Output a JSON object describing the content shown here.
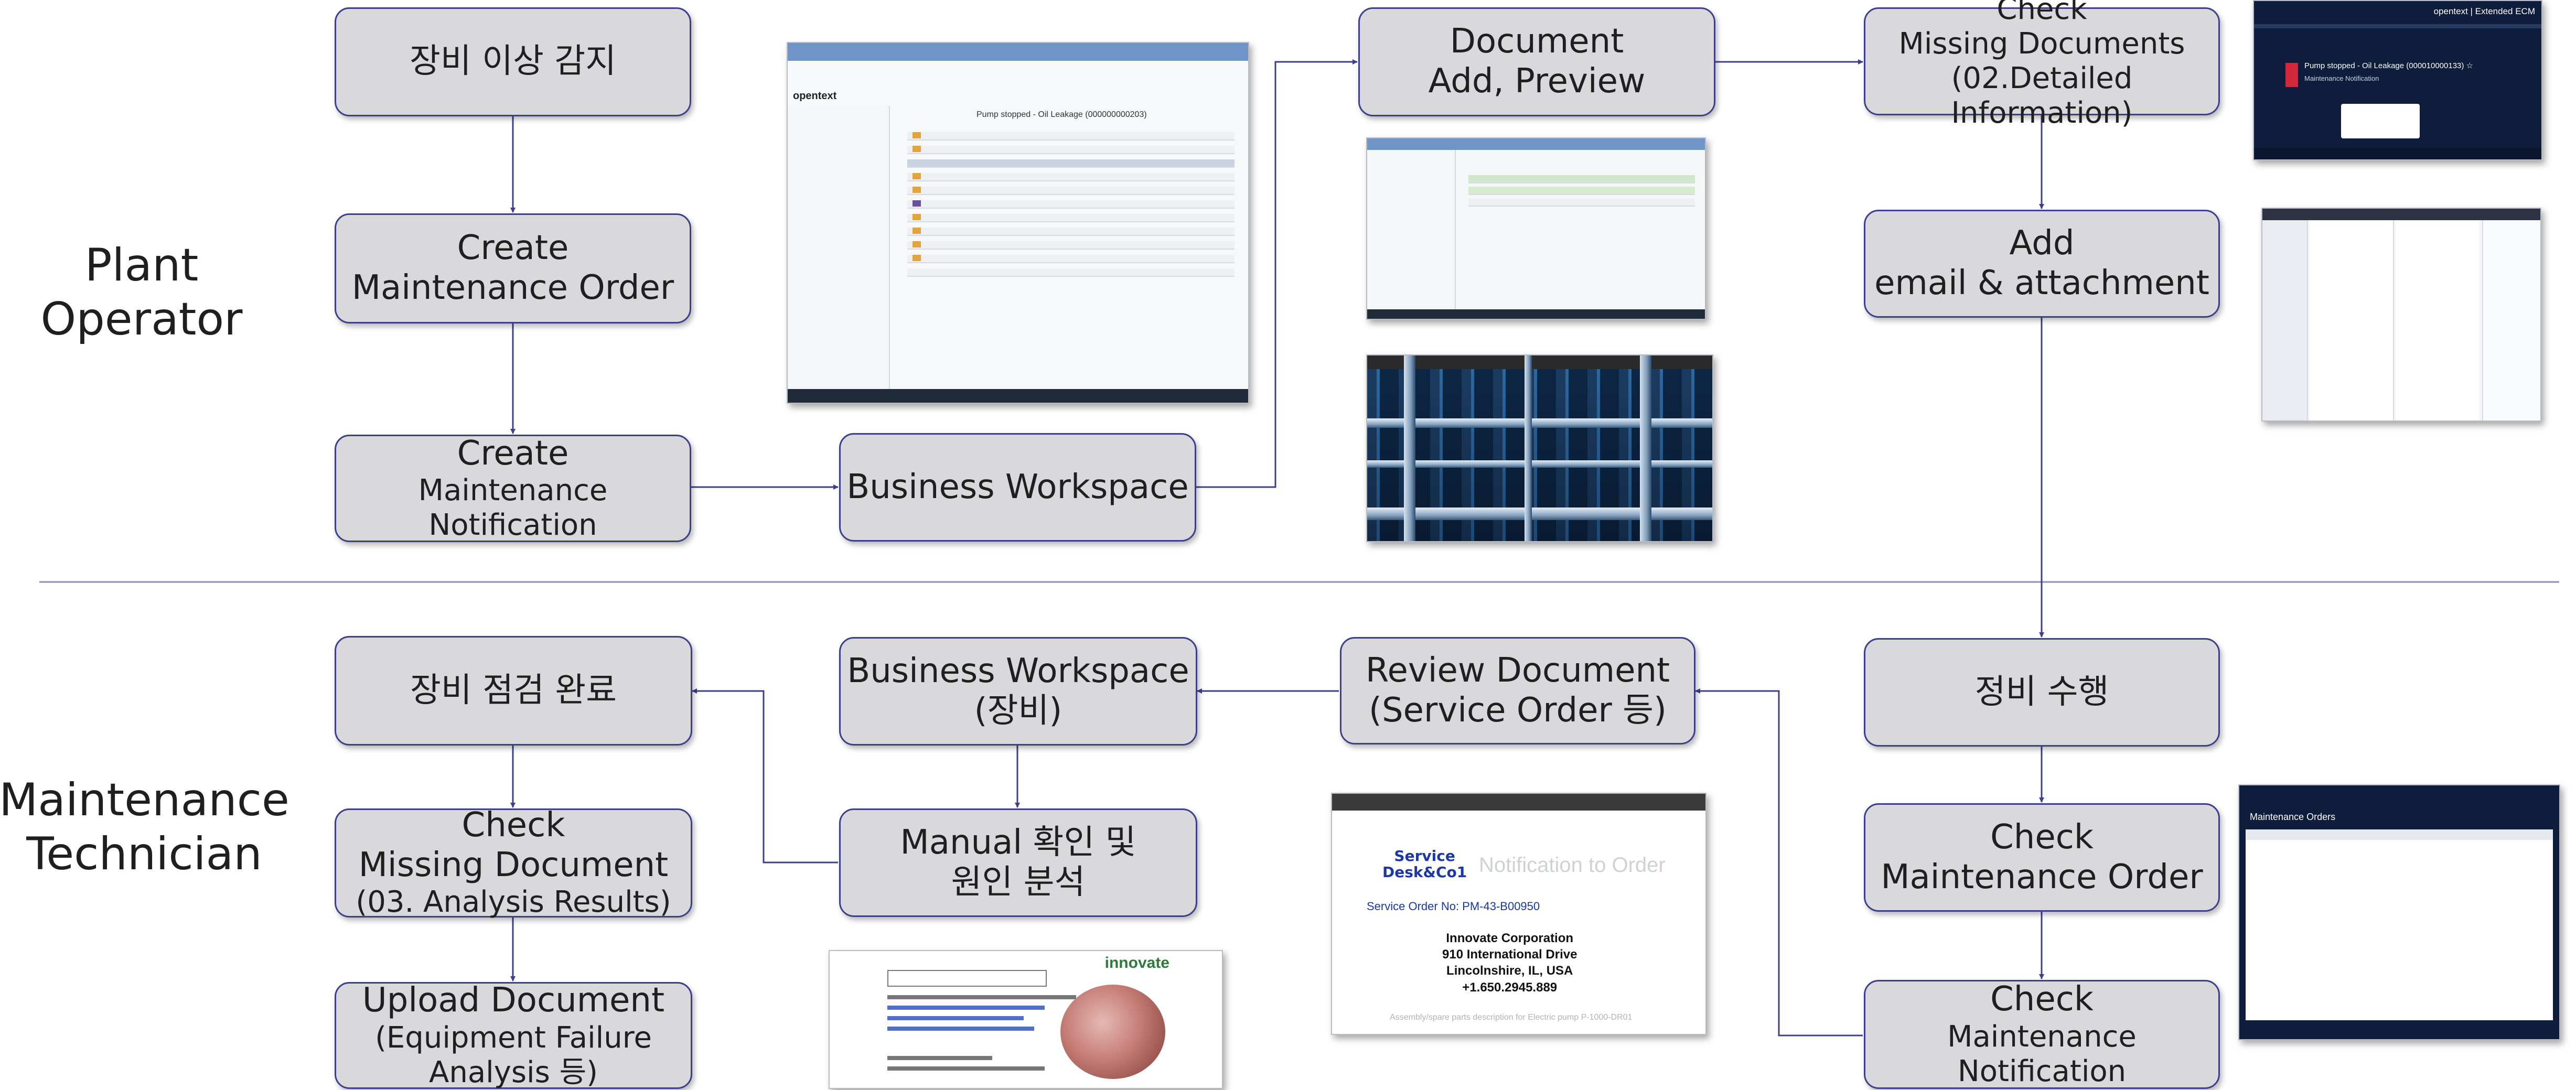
{
  "lanes": {
    "plant_operator": [
      "Plant",
      "Operator"
    ],
    "maintenance_technician": [
      "Maintenance",
      "Technician"
    ]
  },
  "nodes": {
    "equipment_anomaly": [
      "장비 이상 감지"
    ],
    "create_order": [
      "Create",
      "Maintenance Order"
    ],
    "create_notification": [
      "Create",
      "Maintenance Notification"
    ],
    "business_workspace_top": [
      "Business Workspace"
    ],
    "document_add_preview": [
      "Document",
      "Add, Preview"
    ],
    "check_missing_docs_top": [
      "Check",
      "Missing Documents",
      "(02.Detailed Information)"
    ],
    "add_email_attachment": [
      "Add",
      "email & attachment"
    ],
    "perform_maintenance": [
      "정비 수행"
    ],
    "check_maintenance_order": [
      "Check",
      "Maintenance Order"
    ],
    "check_maintenance_notification": [
      "Check",
      "Maintenance Notification"
    ],
    "review_document": [
      "Review Document",
      "(Service Order 등)"
    ],
    "business_workspace_equipment": [
      "Business Workspace",
      "(장비)"
    ],
    "manual_check": [
      "Manual 확인 및",
      "원인 분석"
    ],
    "inspection_complete": [
      "장비 점검 완료"
    ],
    "check_missing_doc_bottom": [
      "Check",
      "Missing Document",
      "(03. Analysis Results)"
    ],
    "upload_document": [
      "Upload Document",
      "(Equipment Failure",
      "Analysis 등)"
    ]
  },
  "thumbnails": {
    "workspace_title": "Pump stopped - Oil Leakage (000000000203)",
    "workspace_brand": "opentext",
    "opentext_header": "opentext | Extended ECM",
    "notification_title": "Pump stopped - Oil Leakage (000010000133) ☆",
    "notification_subtitle": "Maintenance Notification",
    "maintenance_orders_title": "Maintenance Orders",
    "service_desk": [
      "Service",
      "Desk&Co1"
    ],
    "notification_to_order": "Notification to Order",
    "service_order_no": "Service Order No: PM-43-B00950",
    "address": [
      "Innovate Corporation",
      "910 International Drive",
      "Lincolnshire, IL, USA",
      "+1.650.2945.889"
    ],
    "innovate_logo": "innovate",
    "assembly_caption": "Assembly/spare parts description for Electric pump P-1000-DR01"
  },
  "colors": {
    "node_fill": "#d9d9db",
    "node_border": "#3d3f8a",
    "connector": "#3d3f8a"
  }
}
